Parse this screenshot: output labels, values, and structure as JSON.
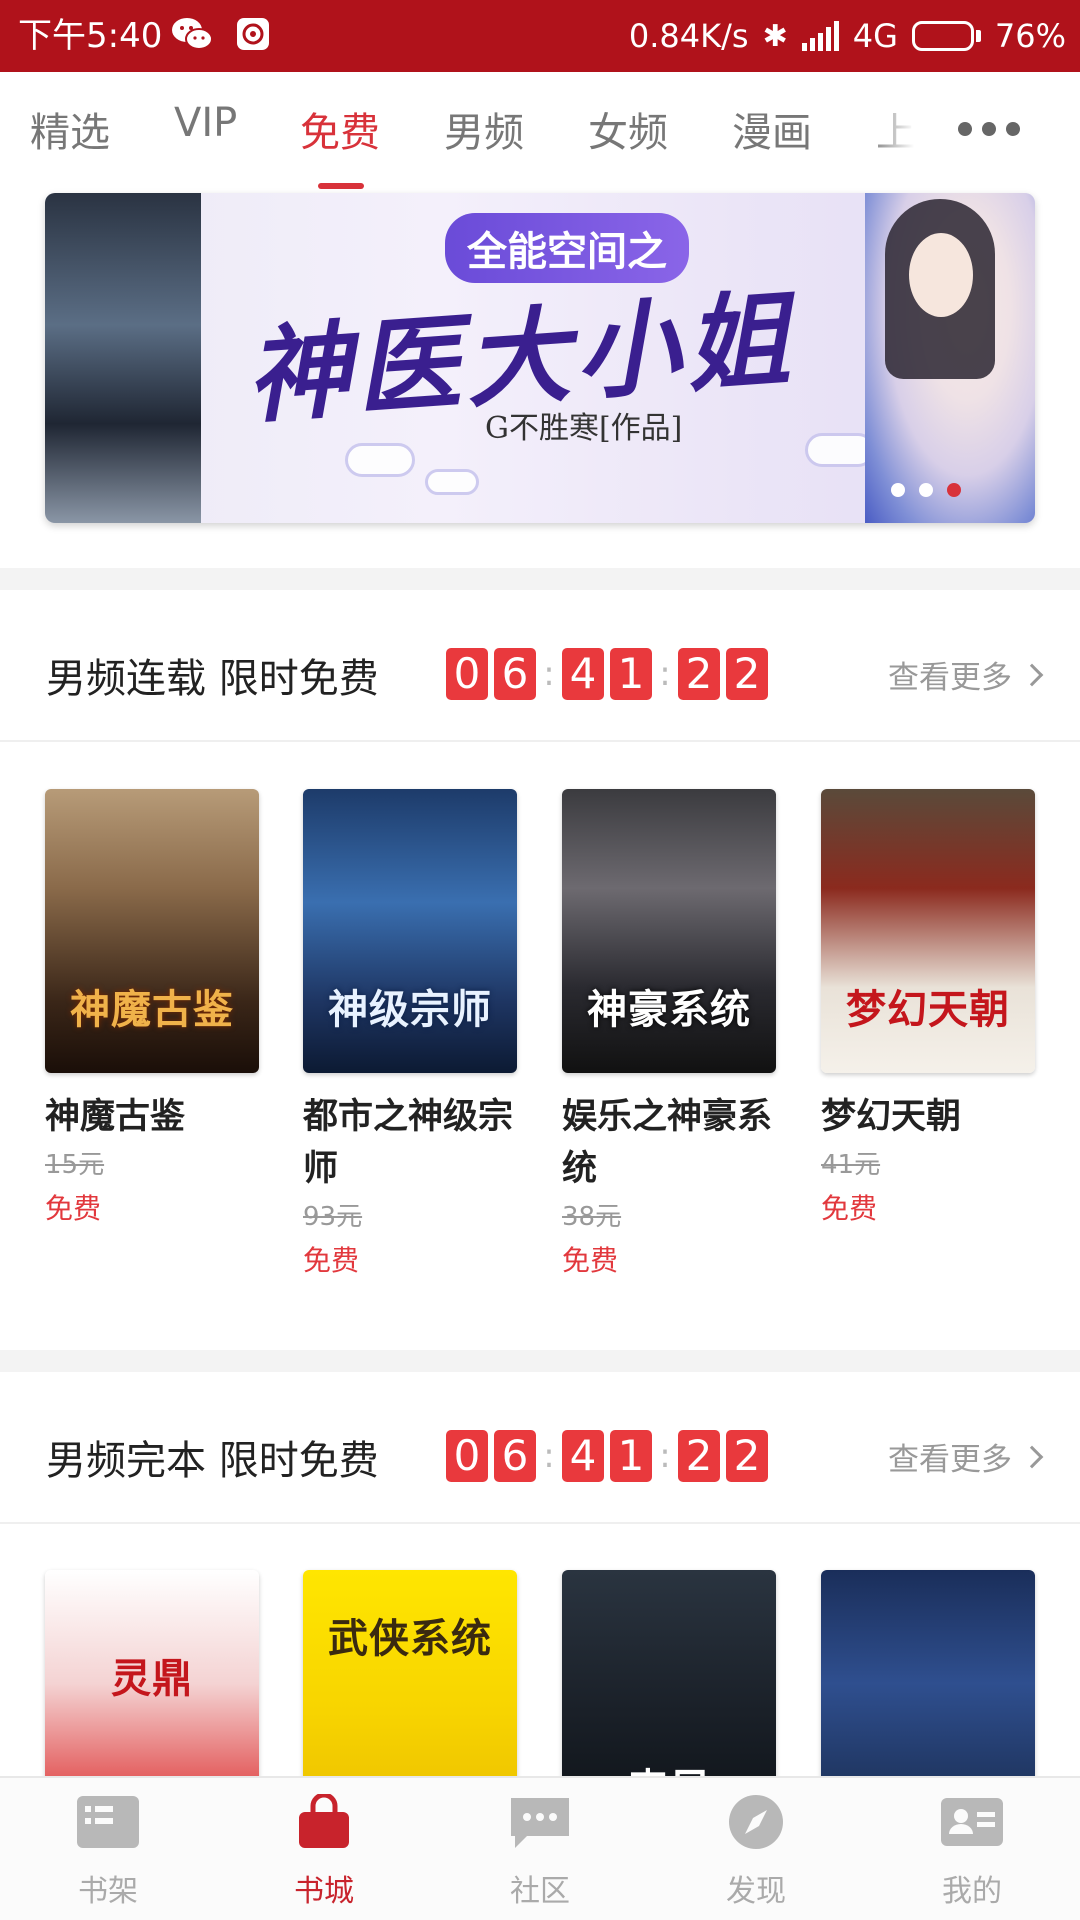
{
  "status_bar": {
    "time": "下午5:40",
    "net_speed": "0.84K/s",
    "network": "4G",
    "battery": "76%",
    "battery_level": 0.76,
    "icons": [
      "wechat-icon",
      "netease-music-icon",
      "bluetooth-icon",
      "signal-icon",
      "battery-icon"
    ]
  },
  "tabs": [
    {
      "label": "精选"
    },
    {
      "label": "VIP"
    },
    {
      "label": "免费",
      "active": true
    },
    {
      "label": "男频"
    },
    {
      "label": "女频"
    },
    {
      "label": "漫画"
    },
    {
      "label": "上"
    }
  ],
  "banner": {
    "tagline": "全能空间之",
    "title": "神医大小姐",
    "author": "G不胜寒[作品]",
    "page_count": 3,
    "active_page": 3
  },
  "sections": [
    {
      "title": "男频连载 限时免费",
      "timer": [
        "0",
        "6",
        "4",
        "1",
        "2",
        "2"
      ],
      "see_more": "查看更多",
      "books": [
        {
          "name": "神魔古鉴",
          "cover_text": "神魔古鉴",
          "orig_price": "15元",
          "price": "免费"
        },
        {
          "name": "都市之神级宗师",
          "cover_text": "神级宗师",
          "orig_price": "93元",
          "price": "免费"
        },
        {
          "name": "娱乐之神豪系统",
          "cover_text": "神豪系统",
          "orig_price": "38元",
          "price": "免费"
        },
        {
          "name": "梦幻天朝",
          "cover_text": "梦幻天朝",
          "orig_price": "41元",
          "price": "免费"
        }
      ]
    },
    {
      "title": "男频完本 限时免费",
      "timer": [
        "0",
        "6",
        "4",
        "1",
        "2",
        "2"
      ],
      "see_more": "查看更多",
      "books": [
        {
          "cover_text": "灵鼎"
        },
        {
          "cover_text": "武侠系统"
        },
        {
          "cover_text": "丧尸"
        },
        {
          "cover_text": ""
        }
      ]
    }
  ],
  "bottom_nav": [
    {
      "label": "书架",
      "icon": "bookshelf-icon"
    },
    {
      "label": "书城",
      "icon": "shopping-bag-icon",
      "active": true
    },
    {
      "label": "社区",
      "icon": "chat-bubble-icon"
    },
    {
      "label": "发现",
      "icon": "compass-icon"
    },
    {
      "label": "我的",
      "icon": "id-card-icon"
    }
  ],
  "colors": {
    "brand_red": "#b0121b",
    "accent_red": "#d8323a",
    "timer_red": "#e9393d"
  }
}
